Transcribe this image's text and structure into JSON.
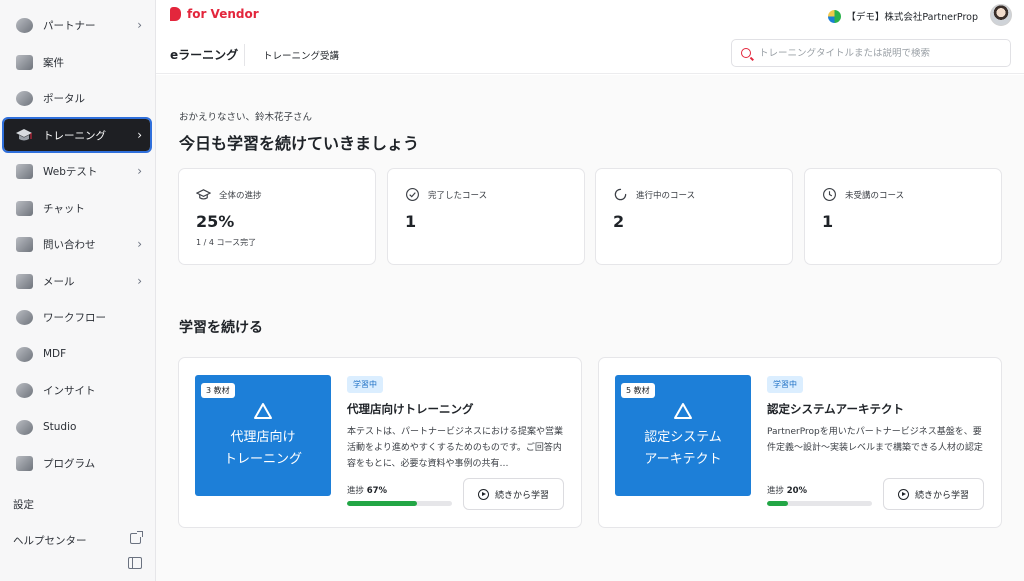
{
  "brand": {
    "name": "for Vendor",
    "color": "#e3263c"
  },
  "account": {
    "company": "【デモ】株式会社PartnerProp",
    "logo_icon": "company-logo-icon",
    "avatar_icon": "user-avatar"
  },
  "sidebar": {
    "items": [
      {
        "label": "パートナー",
        "icon": "partner-icon",
        "has_children": true,
        "chevron": "›"
      },
      {
        "label": "案件",
        "icon": "deal-icon",
        "has_children": false
      },
      {
        "label": "ポータル",
        "icon": "portal-icon",
        "has_children": false
      },
      {
        "label": "トレーニング",
        "icon": "graduation-cap-icon",
        "has_children": true,
        "chevron": "›",
        "active": true
      },
      {
        "label": "Webテスト",
        "icon": "web-test-icon",
        "has_children": true,
        "chevron": "›"
      },
      {
        "label": "チャット",
        "icon": "chat-icon",
        "has_children": false
      },
      {
        "label": "問い合わせ",
        "icon": "inquiry-icon",
        "has_children": true,
        "chevron": "›"
      },
      {
        "label": "メール",
        "icon": "mail-icon",
        "has_children": true,
        "chevron": "›"
      },
      {
        "label": "ワークフロー",
        "icon": "workflow-icon",
        "has_children": false
      },
      {
        "label": "MDF",
        "icon": "mdf-icon",
        "has_children": false
      },
      {
        "label": "インサイト",
        "icon": "insight-icon",
        "has_children": false
      },
      {
        "label": "Studio",
        "icon": "studio-icon",
        "has_children": false
      },
      {
        "label": "プログラム",
        "icon": "program-icon",
        "has_children": false
      }
    ],
    "settings": "設定",
    "help": "ヘルプセンター"
  },
  "subheader": {
    "title": "eラーニング",
    "tab": "トレーニング受講",
    "search_placeholder": "トレーニングタイトルまたは説明で検索"
  },
  "main": {
    "welcome": "おかえりなさい、鈴木花子さん",
    "headline": "今日も学習を続けていきましょう",
    "stats": [
      {
        "label": "全体の進捗",
        "value": "25%",
        "sub": "1 / 4 コース完了",
        "icon": "graduation-cap-icon"
      },
      {
        "label": "完了したコース",
        "value": "1",
        "icon": "check-circle-icon"
      },
      {
        "label": "進行中のコース",
        "value": "2",
        "icon": "loading-icon"
      },
      {
        "label": "未受講のコース",
        "value": "1",
        "icon": "clock-icon"
      }
    ],
    "section_title": "学習を続ける",
    "courses": [
      {
        "count": "3 教材",
        "thumb_title_line1": "代理店向け",
        "thumb_title_line2": "トレーニング",
        "status": "学習中",
        "title": "代理店向けトレーニング",
        "description": "本テストは、パートナービジネスにおける提案や営業活動をより進めやすくするためのものです。ご回答内容をもとに、必要な資料や事例の共有…",
        "progress_label": "進捗",
        "progress_text": "67%",
        "progress": 0.67,
        "button": "続きから学習"
      },
      {
        "count": "5 教材",
        "thumb_title_line1": "認定システム",
        "thumb_title_line2": "アーキテクト",
        "status": "学習中",
        "title": "認定システムアーキテクト",
        "description": "PartnerPropを用いたパートナービジネス基盤を、要件定義〜設計〜実装レベルまで構築できる人材の認定",
        "progress_label": "進捗",
        "progress_text": "20%",
        "progress": 0.2,
        "button": "続きから学習"
      }
    ]
  },
  "colors": {
    "accent": "#e3263c",
    "thumb_bg": "#1d7fd8",
    "progress": "#22a645",
    "active_nav": "#1e1f23"
  }
}
